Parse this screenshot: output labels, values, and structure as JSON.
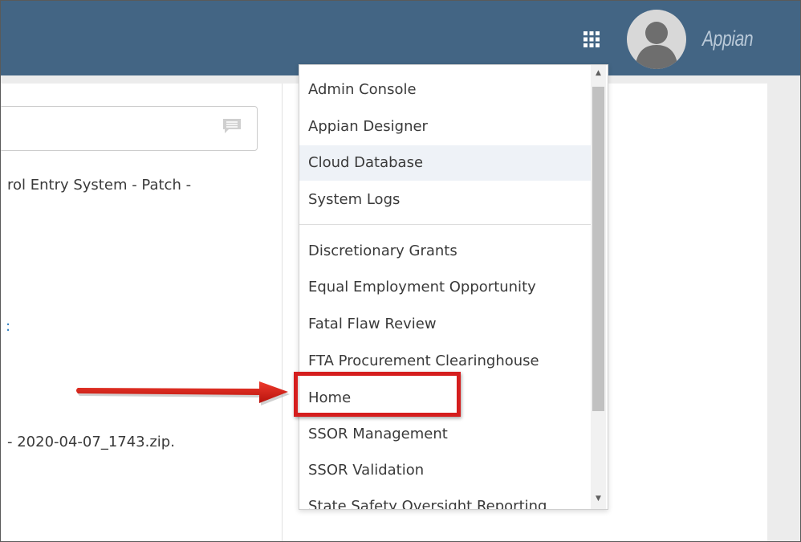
{
  "header": {
    "brand": "Appian",
    "icons": {
      "apps": "grid-icon",
      "avatar": "user-avatar-icon"
    },
    "colors": {
      "bar": "#436584"
    }
  },
  "main": {
    "search": {
      "icon": "comment-icon"
    },
    "lines": [
      "rol Entry System - Patch -",
      "- 2020-04-07_1743.zip."
    ],
    "link_fragment": ":"
  },
  "menu": {
    "items_group1": [
      "Admin Console",
      "Appian Designer",
      "Cloud Database",
      "System Logs"
    ],
    "items_group2": [
      "Discretionary Grants",
      "Equal Employment Opportunity",
      "Fatal Flaw Review",
      "FTA Procurement Clearinghouse",
      "Home",
      "SSOR Management",
      "SSOR Validation",
      "State Safety Oversight Reporting"
    ],
    "highlighted_item": "Cloud Database",
    "annotation": {
      "target": "Home",
      "color": "#d51e1e"
    }
  }
}
